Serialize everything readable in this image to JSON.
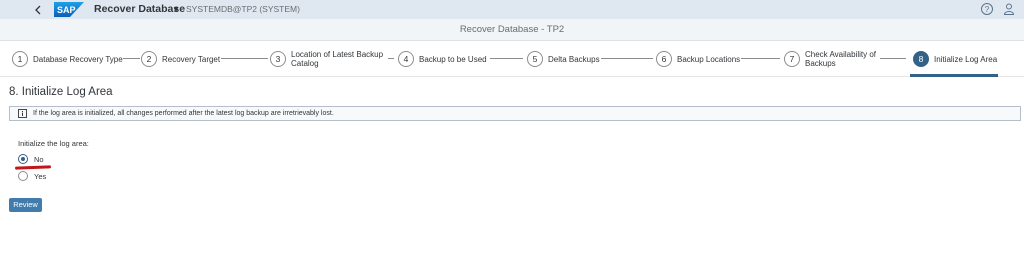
{
  "shell": {
    "app_title": "Recover Database",
    "system": "SYSTEMDB@TP2 (SYSTEM)",
    "logo_text": "SAP",
    "back_icon": "chevron-left-icon",
    "help_icon": "help-icon",
    "user_icon": "user-icon"
  },
  "page": {
    "title": "Recover Database - TP2"
  },
  "wizard": {
    "steps": [
      {
        "num": "1",
        "label": "Database Recovery Type"
      },
      {
        "num": "2",
        "label": "Recovery Target"
      },
      {
        "num": "3",
        "label": "Location of Latest Backup",
        "label2": "Catalog"
      },
      {
        "num": "4",
        "label": "Backup to be Used"
      },
      {
        "num": "5",
        "label": "Delta Backups"
      },
      {
        "num": "6",
        "label": "Backup Locations"
      },
      {
        "num": "7",
        "label": "Check Availability of",
        "label2": "Backups"
      },
      {
        "num": "8",
        "label": "Initialize Log Area"
      }
    ],
    "active_step": 8
  },
  "content": {
    "section_title": "8. Initialize Log Area",
    "info_message": "If the log area is initialized, all changes performed after the latest log backup are irretrievably lost.",
    "field_label": "Initialize the log area:",
    "options": [
      {
        "label": "No",
        "selected": true
      },
      {
        "label": "Yes",
        "selected": false
      }
    ],
    "review_label": "Review"
  },
  "colors": {
    "shell_bg": "#dfe8f1",
    "accent": "#346187",
    "button": "#427cac",
    "annotation": "#c01818"
  }
}
